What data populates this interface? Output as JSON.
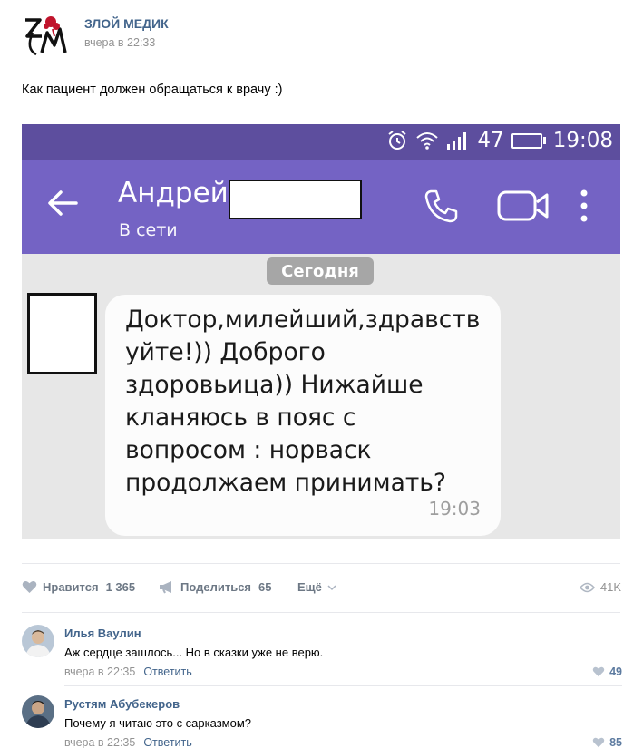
{
  "post": {
    "author": "ЗЛОЙ МЕДИК",
    "time": "вчера в 22:33",
    "text": "Как пациент должен обращаться к врачу :)",
    "logo_text": "ЗМ"
  },
  "screenshot": {
    "status_bar": {
      "signal_level": "47",
      "time": "19:08",
      "battery_level": 0.47
    },
    "contact_name": "Андрей",
    "contact_status": "В сети",
    "date_chip": "Сегодня",
    "message": {
      "text": "Доктор,милейший,здравств\nуйте!)) Доброго\nздоровьица)) Нижайше\nкланяюсь в пояс с\nвопросом : норваск\nпродолжаем принимать?",
      "time": "19:03"
    },
    "colors": {
      "status_bar": "#5d4e9e",
      "app_bar": "#7463c4"
    }
  },
  "actions": {
    "like_label": "Нравится",
    "like_count": "1 365",
    "share_label": "Поделиться",
    "share_count": "65",
    "more_label": "Ещё",
    "views": "41K"
  },
  "comments": [
    {
      "author": "Илья Ваулин",
      "text": "Аж сердце зашлось... Но в сказки уже не верю.",
      "time": "вчера в 22:35",
      "reply_label": "Ответить",
      "likes": "49"
    },
    {
      "author": "Рустям Абубекеров",
      "text": "Почему я читаю это с сарказмом?",
      "time": "вчера в 22:35",
      "reply_label": "Ответить",
      "likes": "85"
    }
  ],
  "icons": [
    "alarm-icon",
    "wifi-icon",
    "signal-icon",
    "battery-icon",
    "back-arrow-icon",
    "phone-icon",
    "video-icon",
    "more-vertical-icon",
    "heart-icon",
    "megaphone-icon",
    "chevron-down-icon",
    "eye-icon"
  ]
}
